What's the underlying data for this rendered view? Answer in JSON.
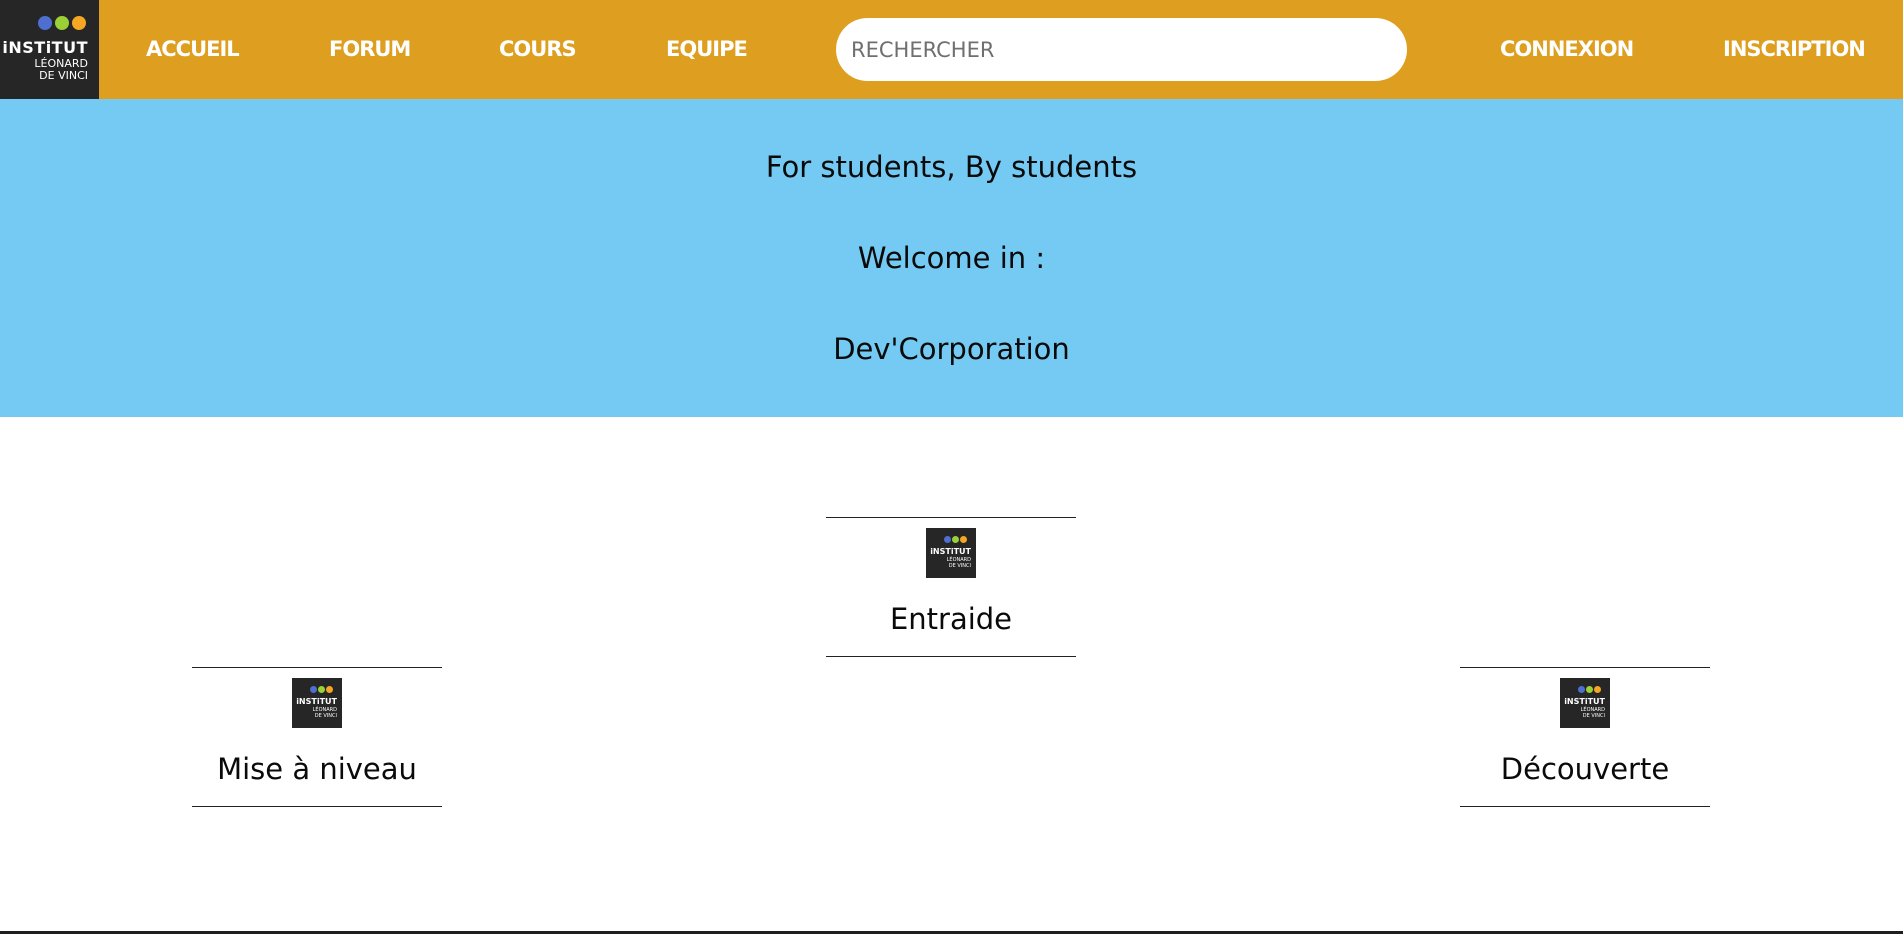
{
  "colors": {
    "navbar_bg": "#DE9E1F",
    "hero_bg": "#74CAF3",
    "logo_bg": "#262626",
    "logo_dot_blue": "#4F6FD0",
    "logo_dot_green": "#9BD136",
    "logo_dot_orange": "#F5A623"
  },
  "logo": {
    "brand": "iNSTiTUT",
    "sub_line1": "LÉONARD",
    "sub_line2": "DE VINCI",
    "icon": "institut-logo-icon"
  },
  "nav": {
    "home": "ACCUEIL",
    "forum": "FORUM",
    "courses": "COURS",
    "team": "EQUIPE",
    "login": "CONNEXION",
    "signup": "INSCRIPTION"
  },
  "search": {
    "placeholder": "RECHERCHER",
    "value": ""
  },
  "hero": {
    "tagline": "For students, By students",
    "welcome": "Welcome in :",
    "org": "Dev'Corporation"
  },
  "cards": [
    {
      "label": "Entraide"
    },
    {
      "label": "Mise à niveau"
    },
    {
      "label": "Découverte"
    }
  ]
}
